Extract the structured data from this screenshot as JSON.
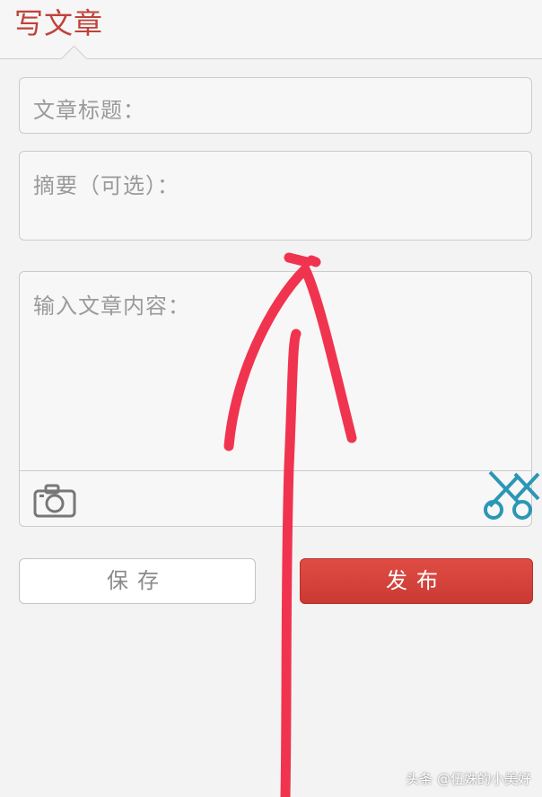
{
  "header": {
    "title": "写文章"
  },
  "form": {
    "title_placeholder": "文章标题：",
    "summary_placeholder": "摘要（可选）：",
    "content_placeholder": "输入文章内容："
  },
  "toolbar": {
    "camera_icon": "camera-icon",
    "scissors_icon": "scissors-icon"
  },
  "buttons": {
    "save_label": "保存",
    "publish_label": "发布"
  },
  "annotation": {
    "arrow_color": "#f0344f"
  },
  "watermark": "头条 @伍姝的小美好",
  "colors": {
    "accent": "#c0423a",
    "publish_bg": "#d5433c"
  }
}
